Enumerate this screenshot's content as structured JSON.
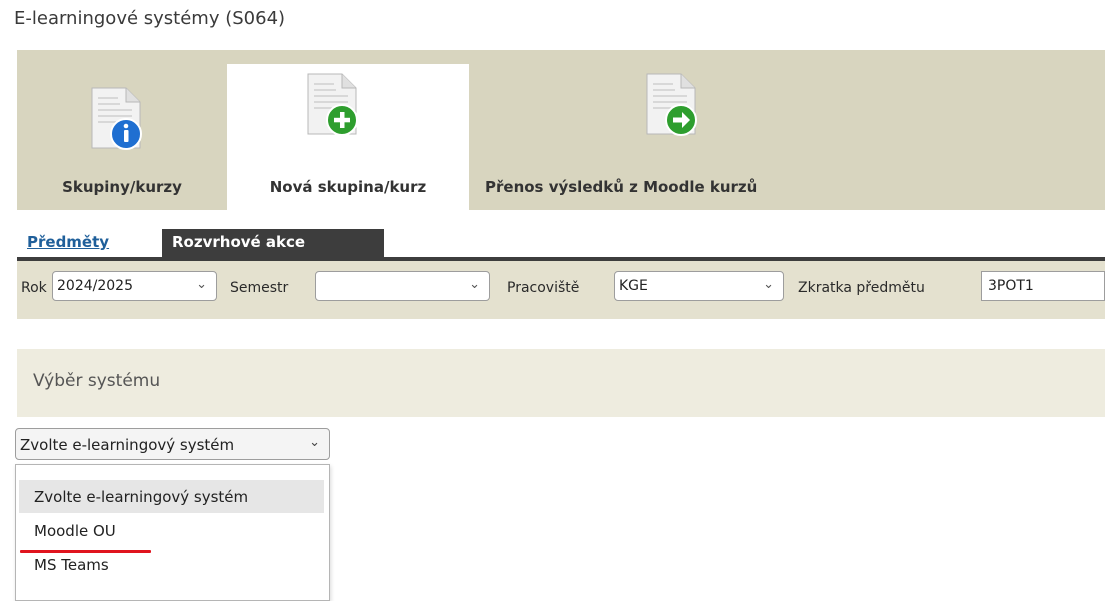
{
  "page": {
    "title": "E-learningové systémy (S064)"
  },
  "toolbar": {
    "buttons": [
      {
        "label": "Skupiny/kurzy",
        "icon": "info-icon",
        "badge_color": "#1f6fd1"
      },
      {
        "label": "Nová skupina/kurz",
        "icon": "plus-icon",
        "badge_color": "#2e9e2e"
      },
      {
        "label": "Přenos výsledků z Moodle kurzů",
        "icon": "arrow-right-icon",
        "badge_color": "#2e9e2e"
      }
    ]
  },
  "subtabs": {
    "link": "Předměty",
    "active": "Rozvrhové akce"
  },
  "filters": {
    "rok_label": "Rok",
    "rok_value": "2024/2025",
    "semestr_label": "Semestr",
    "semestr_value": "",
    "pracoviste_label": "Pracoviště",
    "pracoviste_value": "KGE",
    "zkratka_label": "Zkratka předmětu",
    "zkratka_value": "3POT1"
  },
  "section": {
    "title": "Výběr systému"
  },
  "system_select": {
    "value": "Zvolte e-learningový systém",
    "options": [
      "Zvolte e-learningový systém",
      "Moodle OU",
      "MS Teams"
    ]
  },
  "colors": {
    "toolbar_bg": "#d8d5bf",
    "tab_dark": "#3d3d3d",
    "link": "#1f5f9a",
    "highlight": "#e0141e"
  }
}
